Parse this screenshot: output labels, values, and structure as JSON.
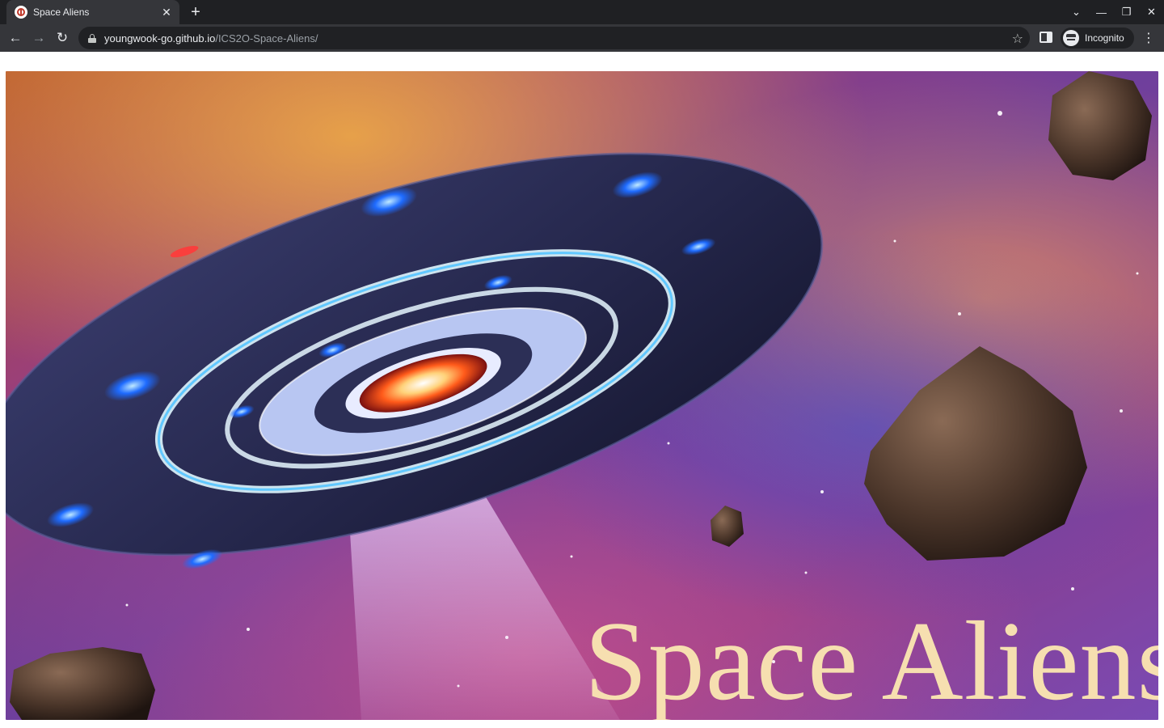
{
  "browser": {
    "tab": {
      "title": "Space Aliens",
      "favicon": "shield-favicon-icon"
    },
    "new_tab_label": "+",
    "url": {
      "host": "youngwook-go.github.io",
      "path": "/ICS2O-Space-Aliens/"
    },
    "profile": {
      "label": "Incognito"
    }
  },
  "page": {
    "banner_title": "Space Aliens",
    "banner_image": "ufo-in-space-with-asteroids"
  },
  "colors": {
    "title_text": "#f6dfb0",
    "browser_frame": "#35363a",
    "browser_tabstrip": "#1f2023"
  }
}
